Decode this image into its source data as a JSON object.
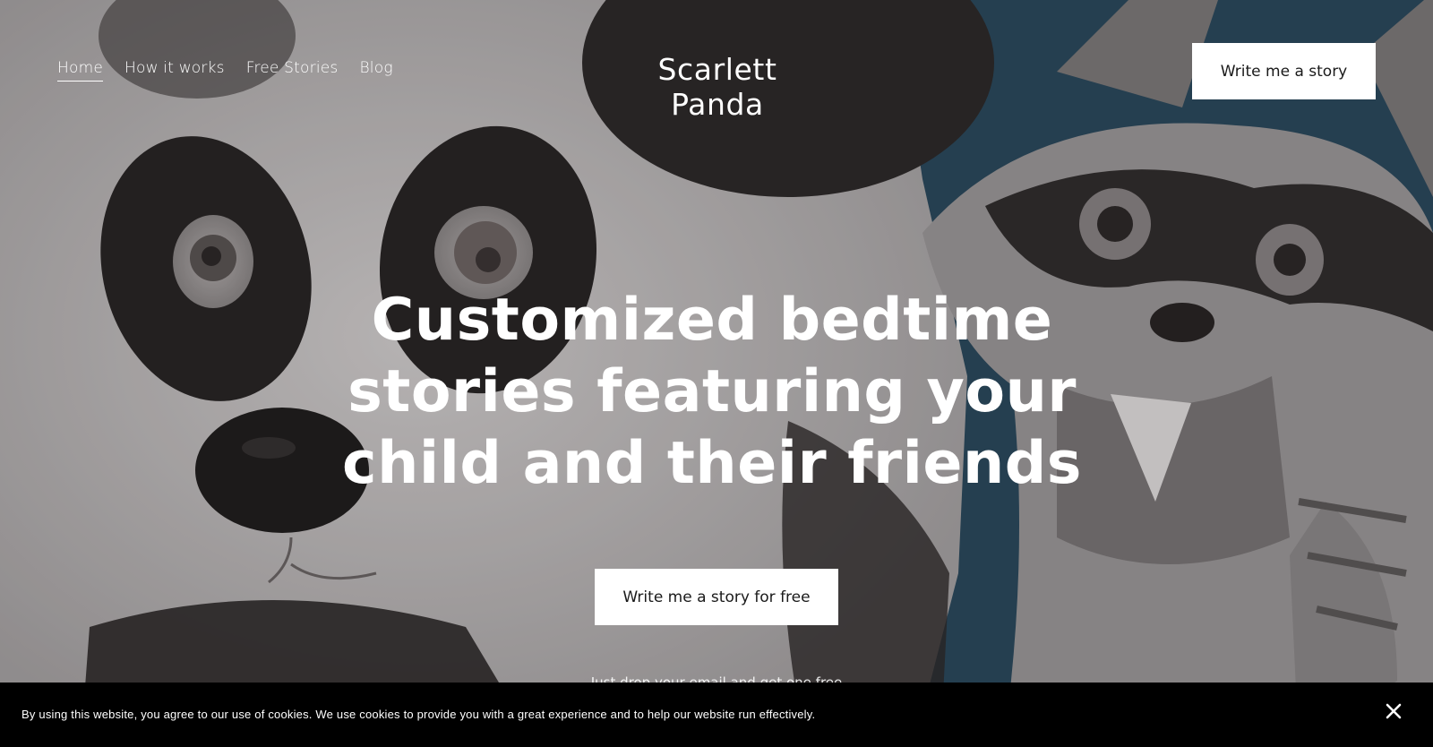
{
  "header": {
    "nav": [
      {
        "label": "Home",
        "active": true
      },
      {
        "label": "How it works",
        "active": false
      },
      {
        "label": "Free Stories",
        "active": false
      },
      {
        "label": "Blog",
        "active": false
      }
    ],
    "site_title": "Scarlett Panda",
    "cta_label": "Write me a story"
  },
  "hero": {
    "headline": "Customized bedtime stories featuring your child and their friends",
    "cta_label": "Write me a story for free",
    "subtext": "Just drop your email and get one free"
  },
  "cookie_banner": {
    "text": "By using this website, you agree to our use of cookies. We use cookies to provide you with a great experience and to help our website run effectively.",
    "close_icon": "close-icon"
  },
  "colors": {
    "banner_bg": "#000000",
    "button_bg": "#ffffff",
    "button_text": "#1a1a1a",
    "hero_text": "#ffffff",
    "backdrop_blue": "#2d4d63"
  }
}
